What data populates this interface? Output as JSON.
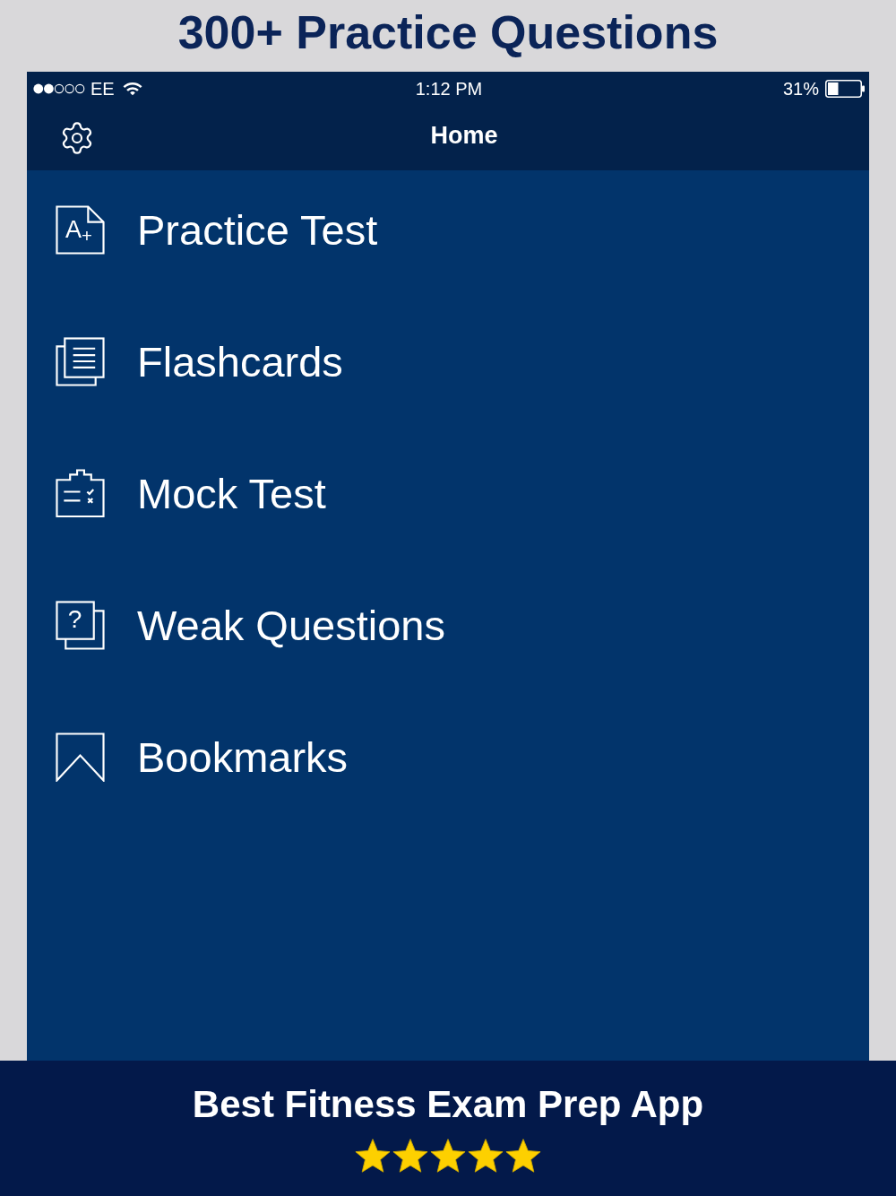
{
  "headline": "300+ Practice Questions",
  "status_bar": {
    "carrier": "EE",
    "time": "1:12 PM",
    "battery": "31%"
  },
  "nav_bar": {
    "title": "Home"
  },
  "menu": [
    {
      "kind": "practice_test",
      "label": "Practice Test",
      "icon_text": "A$_{+}$"
    },
    {
      "kind": "flashcards",
      "label": "Flashcards"
    },
    {
      "kind": "mock_test",
      "label": "Mock Test"
    },
    {
      "kind": "weak_questions",
      "label": "Weak Questions",
      "icon_text": "?"
    },
    {
      "kind": "bookmarks",
      "label": "Bookmarks"
    }
  ],
  "banner": {
    "title": "Best Fitness Exam Prep App",
    "stars": 5
  }
}
